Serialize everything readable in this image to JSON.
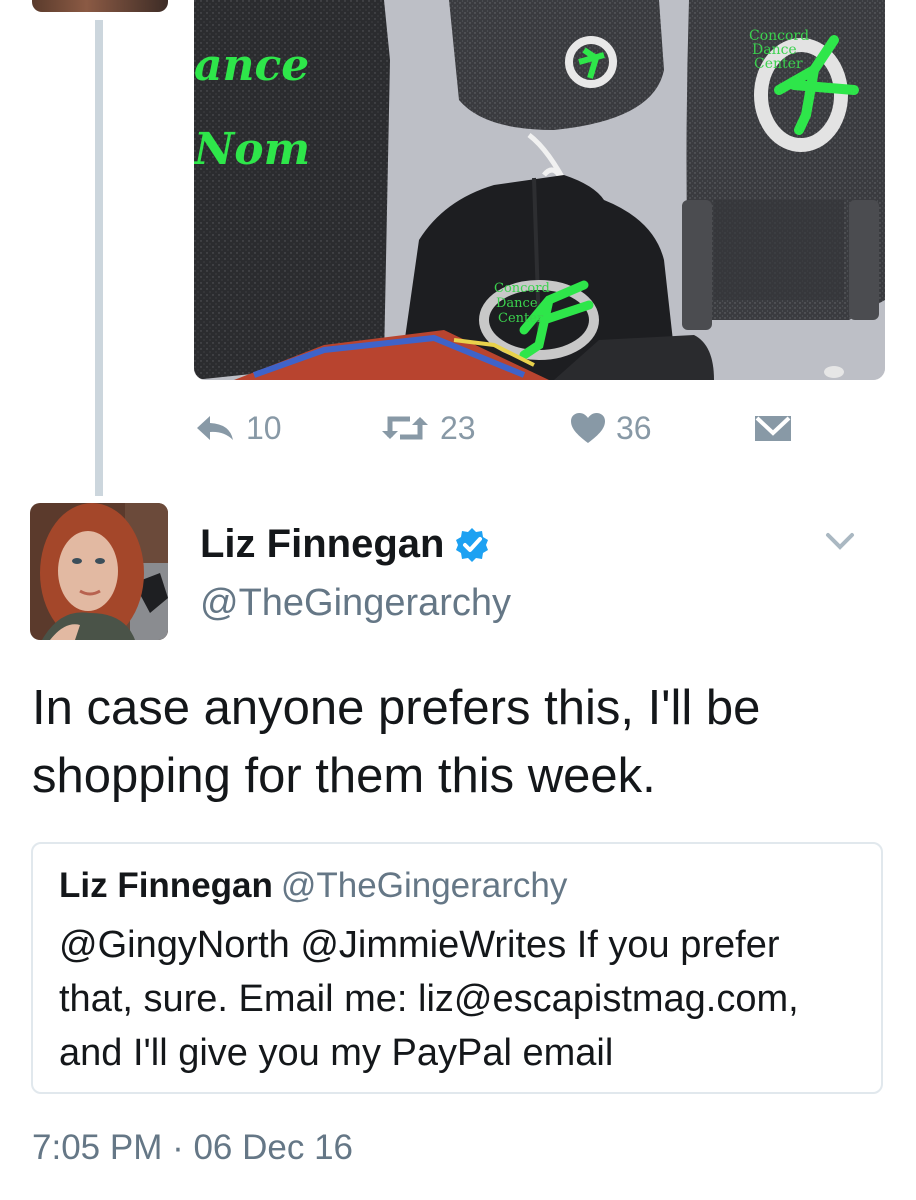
{
  "previous_tweet": {
    "photo": {
      "printed_text": [
        "ance",
        "Nom",
        "Concord",
        "Dance",
        "Center",
        "Concord",
        "Dance",
        "Center"
      ],
      "accent_color": "#2ee64a"
    },
    "actions": {
      "reply": {
        "icon": "reply-icon",
        "count": "10"
      },
      "retweet": {
        "icon": "retweet-icon",
        "count": "23"
      },
      "like": {
        "icon": "heart-icon",
        "count": "36"
      },
      "message": {
        "icon": "envelope-icon"
      }
    }
  },
  "tweet": {
    "author": {
      "name": "Liz Finnegan",
      "handle": "@TheGingerarchy",
      "verified": true
    },
    "text": "In case anyone prefers this, I'll be shopping for them this week.",
    "quoted": {
      "name": "Liz Finnegan",
      "handle": "@TheGingerarchy",
      "text": "@GingyNorth @JimmieWrites If you prefer that, sure. Email me: liz@escapistmag.com, and I'll give you my PayPal email"
    },
    "timestamp": "7:05 PM · 06 Dec 16"
  },
  "colors": {
    "text": "#14171a",
    "secondary": "#657786",
    "icon_gray": "#8899a6",
    "verified_blue": "#1da1f2",
    "border": "#e1e8ed",
    "thread_line": "#ccd6dd"
  }
}
